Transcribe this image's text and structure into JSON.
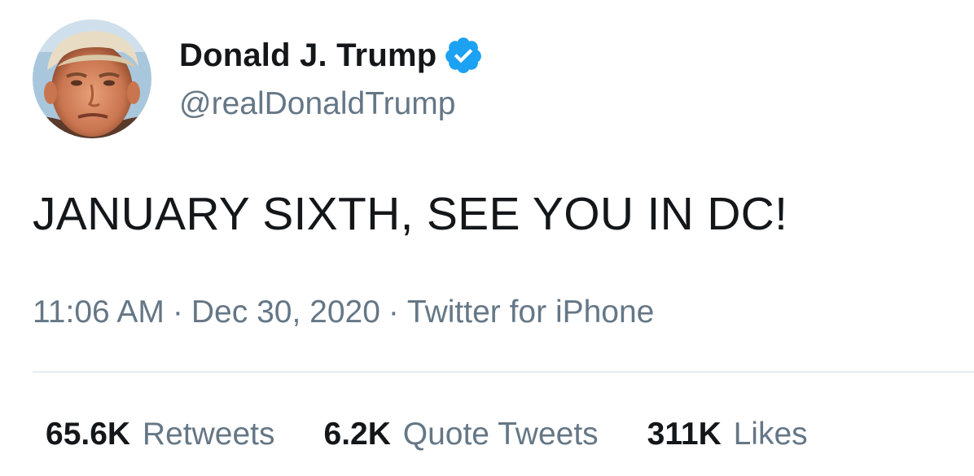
{
  "user": {
    "display_name": "Donald J. Trump",
    "handle": "@realDonaldTrump",
    "verified": true,
    "verified_color": "#1da1f2",
    "avatar_icon": "profile-photo"
  },
  "tweet": {
    "text": "JANUARY SIXTH, SEE YOU IN DC!",
    "time": "11:06 AM",
    "date": "Dec 30, 2020",
    "source": "Twitter for iPhone",
    "separator": "·"
  },
  "stats": {
    "retweets_count": "65.6K",
    "retweets_label": "Retweets",
    "quotes_count": "6.2K",
    "quotes_label": "Quote Tweets",
    "likes_count": "311K",
    "likes_label": "Likes"
  },
  "colors": {
    "text_primary": "#14171a",
    "text_secondary": "#657786",
    "divider": "#e6ecf0"
  }
}
